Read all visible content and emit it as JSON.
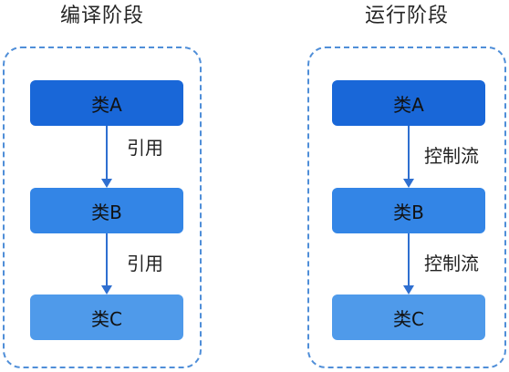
{
  "panels": [
    {
      "title": "编译阶段",
      "nodes": [
        "类A",
        "类B",
        "类C"
      ],
      "edges": [
        "引用",
        "引用"
      ]
    },
    {
      "title": "运行阶段",
      "nodes": [
        "类A",
        "类B",
        "类C"
      ],
      "edges": [
        "控制流",
        "控制流"
      ]
    }
  ],
  "colors": {
    "panel_border": "#4f8ed8",
    "node_fills": [
      "#1967d8",
      "#3385e6",
      "#4f9aea"
    ],
    "arrow": "#2f6fd0"
  }
}
